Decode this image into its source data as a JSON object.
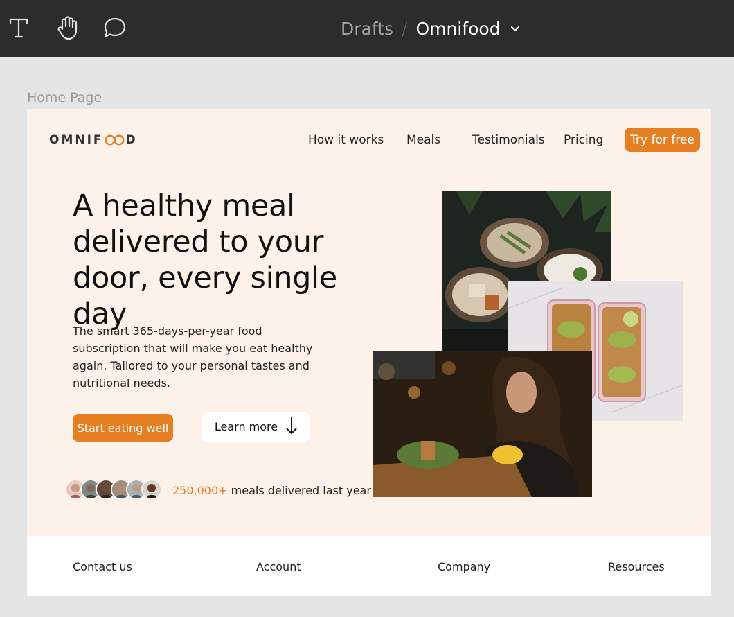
{
  "toolbar": {
    "tools": [
      "text-tool",
      "hand-tool",
      "comment-tool"
    ],
    "breadcrumb_parent": "Drafts",
    "breadcrumb_separator": "/",
    "breadcrumb_current": "Omnifood"
  },
  "canvas": {
    "frame_label": "Home Page",
    "background_color": "#e5e5e5",
    "frame_color": "#fdf2e9"
  },
  "header": {
    "logo": "OMNIFOOD",
    "nav": [
      "How it works",
      "Meals",
      "Testimonials",
      "Pricing"
    ],
    "cta": "Try for free"
  },
  "hero": {
    "title": "A healthy meal delivered to your door, every single day",
    "description": "The smart 365-days-per-year food subscription that will make you eat healthy again. Tailored to your personal tastes and nutritional needs.",
    "primary_button": "Start eating well",
    "secondary_button": "Learn more",
    "delivered_count": "250,000+",
    "delivered_text": "meals delivered last year!",
    "images": [
      "food-bowls-image",
      "meal-prep-boxes-image",
      "woman-eating-image"
    ]
  },
  "footer": {
    "links": [
      "Contact us",
      "Account",
      "Company",
      "Resources"
    ]
  },
  "colors": {
    "accent": "#e67e22",
    "toolbar": "#2c2c2c"
  }
}
